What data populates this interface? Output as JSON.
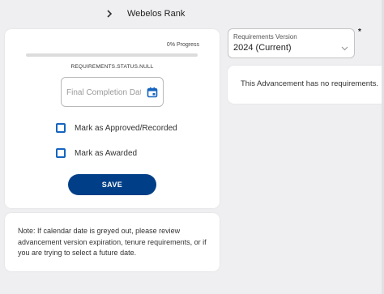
{
  "breadcrumb": {
    "label": "Webelos Rank"
  },
  "progress": {
    "label": "0% Progress",
    "fraction": 0
  },
  "status_key": "REQUIREMENTS.STATUS.NULL",
  "completion_date": {
    "placeholder": "Final Completion Date",
    "value": ""
  },
  "checkboxes": {
    "approved_label": "Mark as Approved/Recorded",
    "awarded_label": "Mark as Awarded"
  },
  "save_label": "SAVE",
  "note": "Note: If calendar date is greyed out, please review advancement version expiration, tenure requirements, or if you are trying to select a future date.",
  "requirements_version": {
    "caption": "Requirements Version",
    "selected": "2024 (Current)",
    "required_marker": "*"
  },
  "no_requirements_message": "This Advancement has no requirements.",
  "colors": {
    "primary": "#003f87",
    "checkbox": "#1565c0",
    "background": "#efeff1"
  },
  "icons": {
    "breadcrumb": "chevron-right-icon",
    "date": "calendar-icon",
    "select": "chevron-down-icon"
  }
}
